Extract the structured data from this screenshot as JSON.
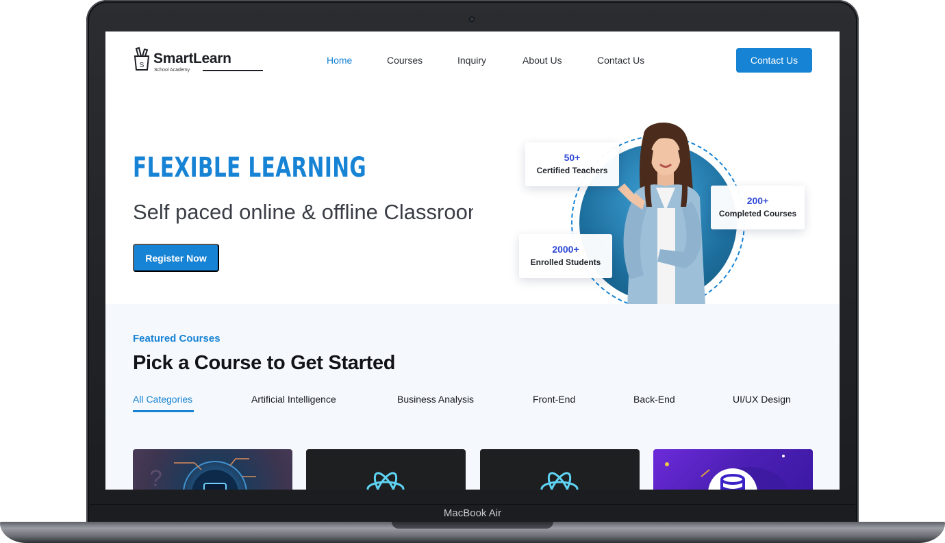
{
  "device": {
    "label": "MacBook Air"
  },
  "nav": {
    "brand_name": "SmartLearn",
    "brand_tagline": "School Academy",
    "items": [
      {
        "label": "Home",
        "active": true
      },
      {
        "label": "Courses",
        "active": false
      },
      {
        "label": "Inquiry",
        "active": false
      },
      {
        "label": "About Us",
        "active": false
      },
      {
        "label": "Contact Us",
        "active": false
      }
    ],
    "cta_label": "Contact Us"
  },
  "hero": {
    "title": "FLEXIBLE LEARNING",
    "subtitle": "Self paced online & offline Classroom",
    "register_label": "Register Now",
    "stats": [
      {
        "value": "50+",
        "label": "Certified Teachers"
      },
      {
        "value": "200+",
        "label": "Completed Courses"
      },
      {
        "value": "2000+",
        "label": "Enrolled Students"
      }
    ]
  },
  "courses": {
    "eyebrow": "Featured Courses",
    "title": "Pick a Course to Get Started",
    "tabs": [
      {
        "label": "All Categories",
        "active": true
      },
      {
        "label": "Artificial Intelligence",
        "active": false
      },
      {
        "label": "Business Analysis",
        "active": false
      },
      {
        "label": "Front-End",
        "active": false
      },
      {
        "label": "Back-End",
        "active": false
      },
      {
        "label": "UI/UX Design",
        "active": false
      }
    ],
    "cards": [
      {
        "icon": "ai-chip-icon"
      },
      {
        "icon": "react-atom-icon"
      },
      {
        "icon": "react-atom-icon"
      },
      {
        "icon": "database-icon"
      }
    ]
  },
  "colors": {
    "accent": "#1783d4",
    "stat_number": "#2f49d6",
    "section_bg": "#f5f8fc"
  }
}
